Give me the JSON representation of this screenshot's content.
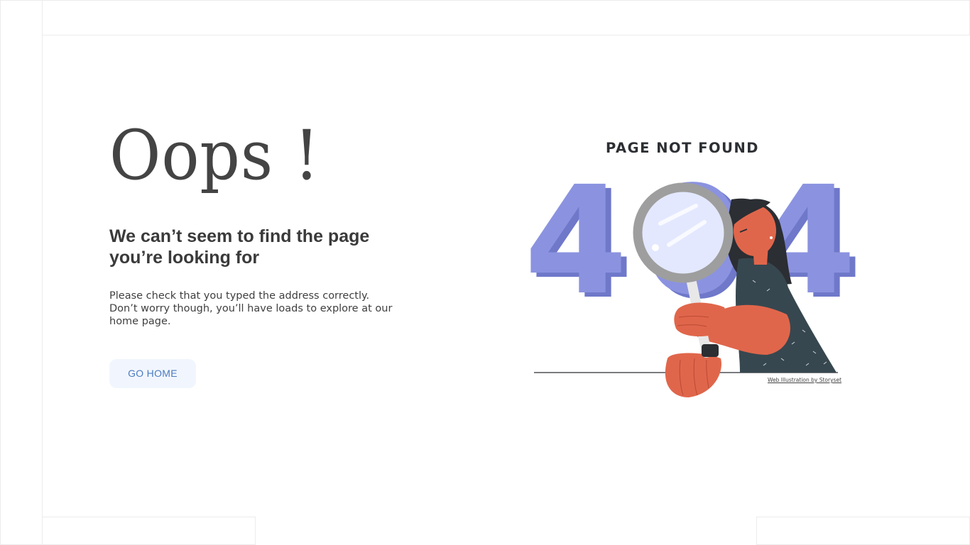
{
  "main": {
    "title": "Oops !",
    "headline": "We can’t seem to find the page you’re looking for",
    "description": "Please check that you typed the address correctly. Don’t worry though, you’ll have loads to explore at our home page.",
    "go_home_label": "GO HOME"
  },
  "illustration": {
    "title": "PAGE NOT FOUND",
    "digits": [
      "4",
      "0",
      "4"
    ],
    "credit": "Web Illustration by Storyset"
  },
  "colors": {
    "accent": "#8b93e0",
    "button_bg": "#f1f6fe",
    "button_text": "#4a7bbf",
    "skin": "#e0664b",
    "shirt": "#37474f"
  }
}
